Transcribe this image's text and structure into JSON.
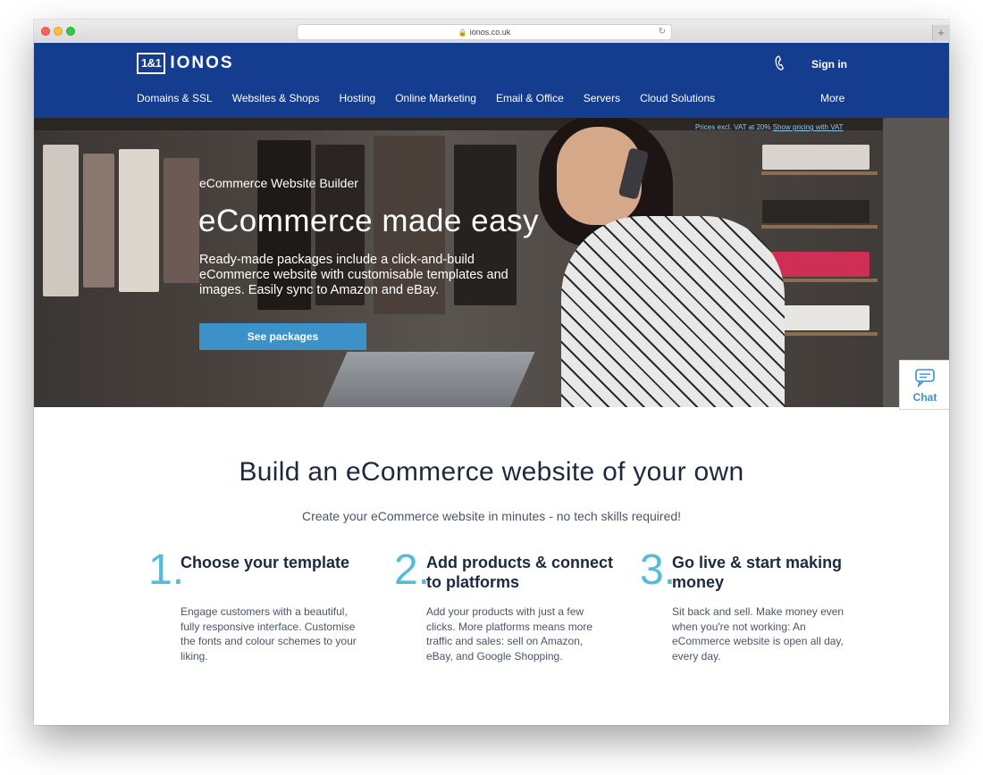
{
  "browser": {
    "url": "ionos.co.uk"
  },
  "header": {
    "logo_box": "1&1",
    "logo_text": "IONOS",
    "signin": "Sign in",
    "nav": [
      "Domains & SSL",
      "Websites & Shops",
      "Hosting",
      "Online Marketing",
      "Email & Office",
      "Servers",
      "Cloud Solutions"
    ],
    "more": "More"
  },
  "hero": {
    "price_note": "Prices excl. VAT at 20%",
    "price_link": "Show pricing with VAT",
    "subtitle": "eCommerce Website Builder",
    "title": "eCommerce made easy",
    "description": "Ready-made packages include a click-and-build eCommerce website with customisable templates and images. Easily sync to Amazon and eBay.",
    "button": "See packages"
  },
  "chat": {
    "label": "Chat"
  },
  "main": {
    "title": "Build an eCommerce website of your own",
    "subtitle": "Create your eCommerce website in minutes - no tech skills required!",
    "steps": [
      {
        "num": "1.",
        "title": "Choose your template",
        "desc": "Engage customers with a beautiful, fully responsive interface. Customise the fonts and colour schemes to your liking."
      },
      {
        "num": "2.",
        "title": "Add products & connect to platforms",
        "desc": "Add your products with just a few clicks. More platforms means more traffic and sales: sell on Amazon, eBay, and Google Shopping."
      },
      {
        "num": "3.",
        "title": "Go live & start making money",
        "desc": "Sit back and sell. Make money even when you're not working: An eCommerce website is open all day, every day."
      }
    ]
  },
  "colors": {
    "header_bg": "#143c8f",
    "accent": "#3c91c8",
    "step_number": "#54bbd8",
    "heading": "#1d2940"
  }
}
